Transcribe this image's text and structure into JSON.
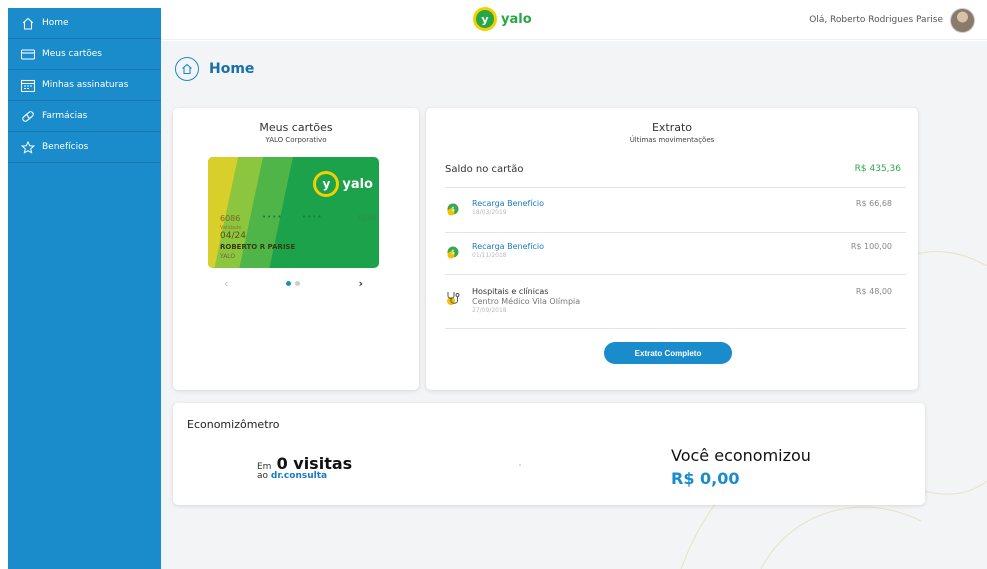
{
  "sidebar": {
    "items": [
      {
        "label": "Home",
        "icon": "home-icon"
      },
      {
        "label": "Meus cartões",
        "icon": "card-icon"
      },
      {
        "label": "Minhas assinaturas",
        "icon": "calendar-icon"
      },
      {
        "label": "Farmácias",
        "icon": "pill-icon"
      },
      {
        "label": "Benefícios",
        "icon": "star-icon"
      }
    ]
  },
  "header": {
    "logo_text": "yalo",
    "logo_letter": "y",
    "greeting": "Olá, Roberto Rodrigues Parise"
  },
  "page": {
    "title": "Home"
  },
  "cards_panel": {
    "title": "Meus cartões",
    "subtitle": "YALO Corporativo",
    "card": {
      "logo_letter": "y",
      "logo_text": "yalo",
      "number_block_1": "6086",
      "number_block_2": "••••",
      "number_block_3": "••••",
      "number_block_4": "7336",
      "validity_label": "Validade",
      "validity": "04/24",
      "holder": "ROBERTO R PARISE",
      "issuer": "YALO"
    },
    "prev_arrow": "‹",
    "next_arrow": "›"
  },
  "extrato": {
    "title": "Extrato",
    "subtitle": "Últimas movimentações",
    "balance_label": "Saldo no cartão",
    "balance_value": "R$ 435,36",
    "transactions": [
      {
        "title": "Recarga Benefício",
        "date": "18/03/2019",
        "value": "R$ 66,68"
      },
      {
        "title": "Recarga Benefício",
        "date": "01/11/2018",
        "value": "R$ 100,00"
      },
      {
        "title": "Hospitais e clínicas",
        "place": "Centro Médico Vila Olímpia",
        "date": "27/09/2018",
        "value": "R$ 48,00"
      }
    ],
    "button_label": "Extrato Completo"
  },
  "economizometro": {
    "title": "Economizômetro",
    "em": "Em",
    "visits": "0 visitas",
    "ao": "ao",
    "brand": "dr.consulta",
    "saved_label": "Você economizou",
    "saved_value": "R$ 0,00"
  },
  "colors": {
    "sidebar": "#1a8bcb",
    "brand_green": "#28a745",
    "accent_blue": "#1a8bcb"
  }
}
